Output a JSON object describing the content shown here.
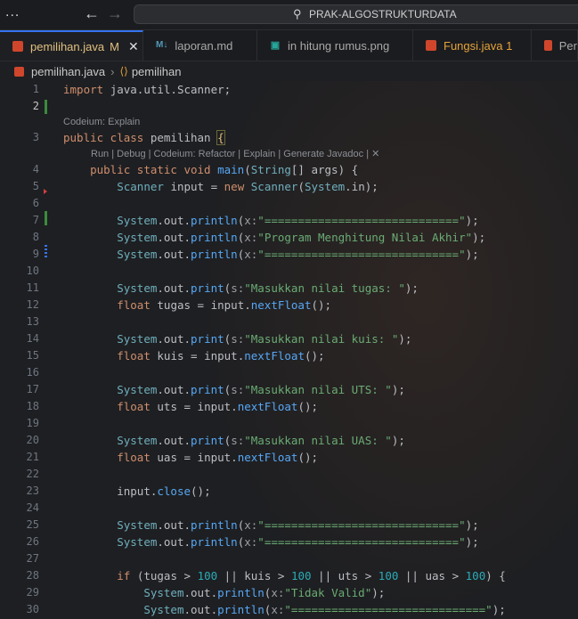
{
  "titlebar": {
    "more_label": "...",
    "back_icon": "arrow-left-icon",
    "forward_icon": "arrow-right-icon",
    "search_text": "PRAK-ALGOSTRUKTURDATA"
  },
  "tabs": [
    {
      "label": "pemilihan.java",
      "status": "M",
      "active": true,
      "icon": "java-icon"
    },
    {
      "label": "laporan.md",
      "icon": "markdown-icon"
    },
    {
      "label": "in hitung rumus.png",
      "icon": "image-icon"
    },
    {
      "label": "Fungsi.java 1",
      "icon": "java-icon"
    },
    {
      "label": "Per",
      "icon": "java-icon"
    }
  ],
  "breadcrumb": {
    "file": "pemilihan.java",
    "symbol": "pemilihan"
  },
  "codelens": {
    "class_lens": "Codeium: Explain",
    "method_lens": "Run | Debug | Codeium: Refactor | Explain | Generate Javadoc | ✕"
  },
  "code_lines": [
    {
      "n": "1",
      "text": "import java.util.Scanner;"
    },
    {
      "n": "2",
      "text": ""
    },
    {
      "n": "3",
      "text": "public class pemilihan {"
    },
    {
      "n": "4",
      "text": "    public static void main(String[] args) {"
    },
    {
      "n": "5",
      "text": "        Scanner input = new Scanner(System.in);"
    },
    {
      "n": "6",
      "text": ""
    },
    {
      "n": "7",
      "text": "        System.out.println(x:\"=============================\");"
    },
    {
      "n": "8",
      "text": "        System.out.println(x:\"Program Menghitung Nilai Akhir\");"
    },
    {
      "n": "9",
      "text": "        System.out.println(x:\"=============================\");"
    },
    {
      "n": "10",
      "text": ""
    },
    {
      "n": "11",
      "text": "        System.out.print(s:\"Masukkan nilai tugas: \");"
    },
    {
      "n": "12",
      "text": "        float tugas = input.nextFloat();"
    },
    {
      "n": "13",
      "text": ""
    },
    {
      "n": "14",
      "text": "        System.out.print(s:\"Masukkan nilai kuis: \");"
    },
    {
      "n": "15",
      "text": "        float kuis = input.nextFloat();"
    },
    {
      "n": "16",
      "text": ""
    },
    {
      "n": "17",
      "text": "        System.out.print(s:\"Masukkan nilai UTS: \");"
    },
    {
      "n": "18",
      "text": "        float uts = input.nextFloat();"
    },
    {
      "n": "19",
      "text": ""
    },
    {
      "n": "20",
      "text": "        System.out.print(s:\"Masukkan nilai UAS: \");"
    },
    {
      "n": "21",
      "text": "        float uas = input.nextFloat();"
    },
    {
      "n": "22",
      "text": ""
    },
    {
      "n": "23",
      "text": "        input.close();"
    },
    {
      "n": "24",
      "text": ""
    },
    {
      "n": "25",
      "text": "        System.out.println(x:\"=============================\");"
    },
    {
      "n": "26",
      "text": "        System.out.println(x:\"=============================\");"
    },
    {
      "n": "27",
      "text": ""
    },
    {
      "n": "28",
      "text": "        if (tugas > 100 || kuis > 100 || uts > 100 || uas > 100) {"
    },
    {
      "n": "29",
      "text": "            System.out.println(x:\"Tidak Valid\");"
    },
    {
      "n": "30",
      "text": "            System.out.println(x:\"=============================\");"
    }
  ]
}
